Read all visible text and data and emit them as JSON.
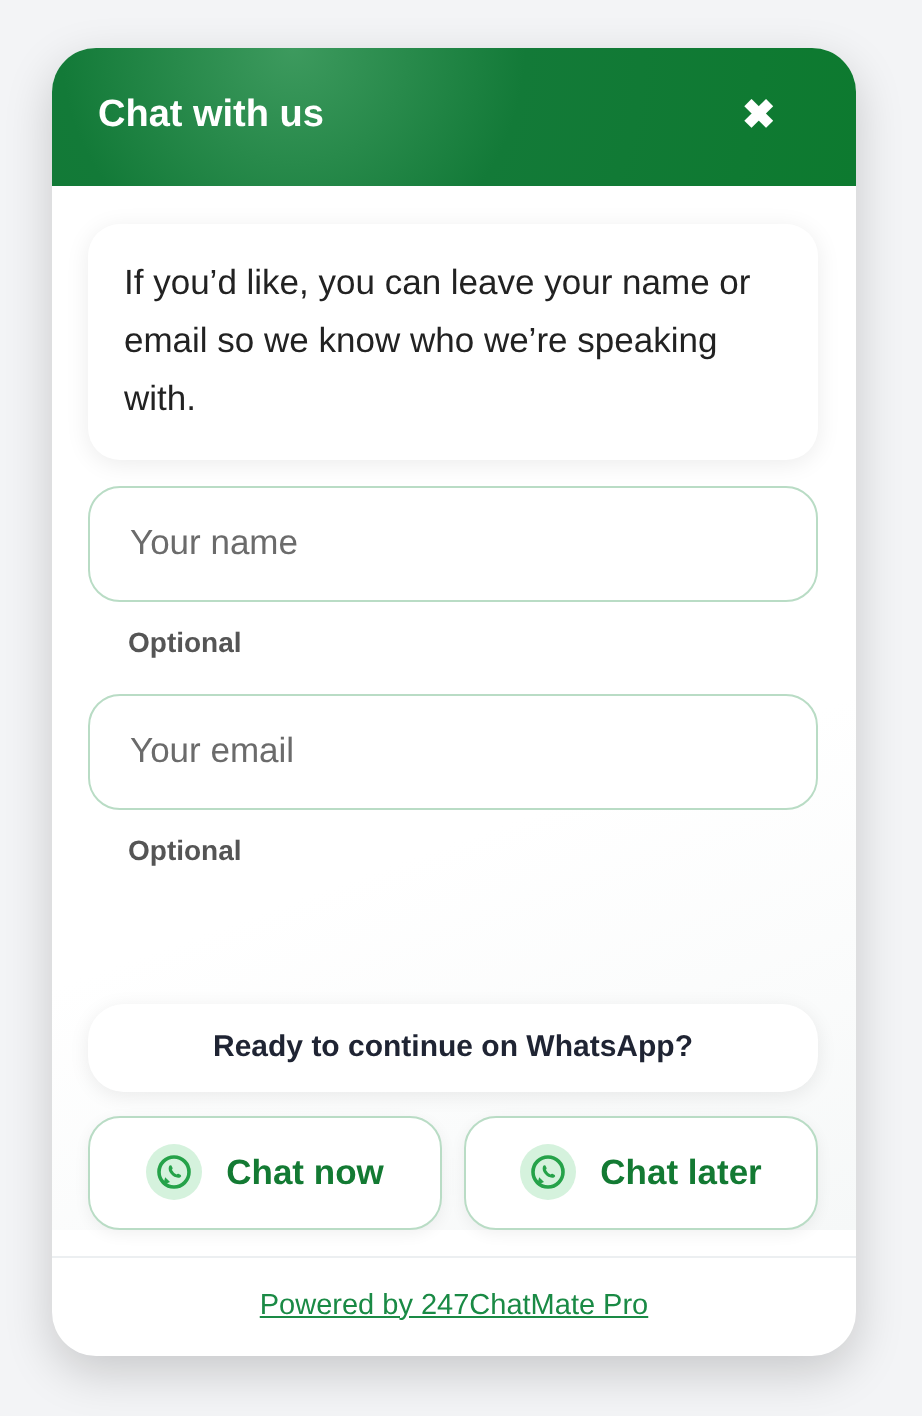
{
  "header": {
    "title": "Chat with us",
    "close": "✖"
  },
  "message": "If you’d like, you can leave your name or email so we know who we’re speaking with.",
  "fields": [
    {
      "placeholder": "Your name",
      "hint": "Optional"
    },
    {
      "placeholder": "Your email",
      "hint": "Optional"
    }
  ],
  "prompt": "Ready to continue on WhatsApp?",
  "buttons": [
    {
      "label": "Chat now"
    },
    {
      "label": "Chat later"
    }
  ],
  "footer": {
    "link": "Powered by 247ChatMate Pro"
  }
}
